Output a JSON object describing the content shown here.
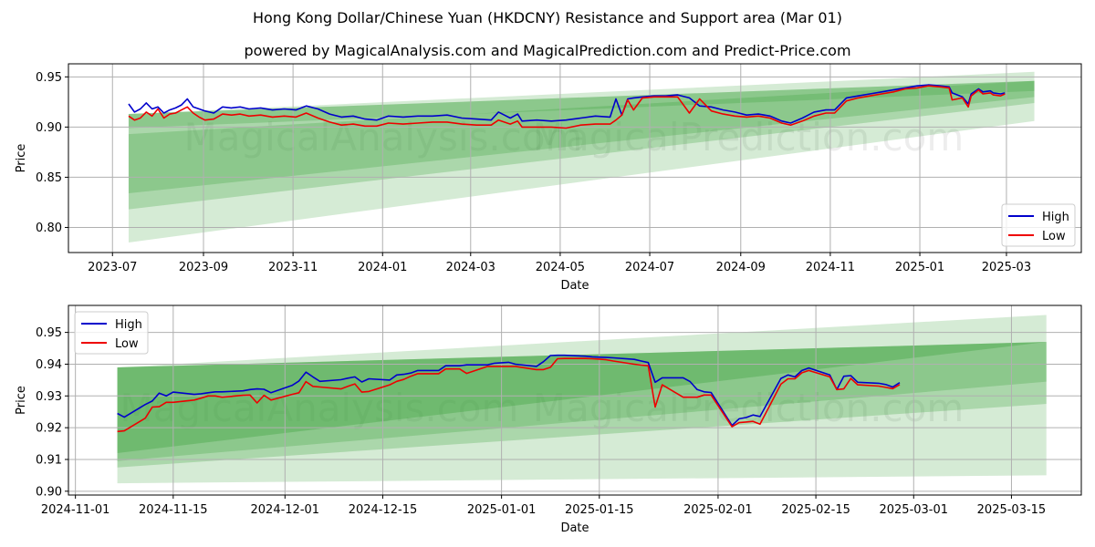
{
  "title": "Hong Kong Dollar/Chinese Yuan (HKDCNY) Resistance and Support area (Mar 01)",
  "subtitle": "powered by MagicalAnalysis.com and MagicalPrediction.com and Predict-Price.com",
  "watermarks": [
    "MagicalAnalysis.com",
    "MagicalPrediction.com"
  ],
  "colors": {
    "high": "#0000cc",
    "low": "#ee0000",
    "band": "#2e9a2e",
    "grid": "#b0b0b0"
  },
  "chart_data": [
    {
      "type": "line",
      "title": "",
      "xlabel": "Date",
      "ylabel": "Price",
      "x_ticks": [
        "2023-07",
        "2023-09",
        "2023-11",
        "2024-01",
        "2024-03",
        "2024-05",
        "2024-07",
        "2024-09",
        "2024-11",
        "2025-01",
        "2025-03"
      ],
      "y_ticks": [
        "0.80",
        "0.85",
        "0.90",
        "0.95"
      ],
      "xlim": [
        "2023-06-01",
        "2025-04-21"
      ],
      "ylim": [
        0.775,
        0.963
      ],
      "grid": true,
      "legend_position": "bottom-right",
      "legend": [
        "High",
        "Low"
      ],
      "bands": [
        {
          "x": [
            "2023-07-12",
            "2025-03-20"
          ],
          "lower": [
            0.785,
            0.906
          ],
          "upper": [
            0.913,
            0.955
          ],
          "alpha": 0.2
        },
        {
          "x": [
            "2023-07-12",
            "2025-03-20"
          ],
          "lower": [
            0.818,
            0.924
          ],
          "upper": [
            0.913,
            0.946
          ],
          "alpha": 0.25
        },
        {
          "x": [
            "2023-07-12",
            "2025-03-20"
          ],
          "lower": [
            0.834,
            0.93
          ],
          "upper": [
            0.893,
            0.946
          ],
          "alpha": 0.25
        },
        {
          "x": [
            "2023-07-12",
            "2025-03-20"
          ],
          "lower": [
            0.899,
            0.936
          ],
          "upper": [
            0.913,
            0.946
          ],
          "alpha": 0.25
        }
      ],
      "series": [
        {
          "name": "High",
          "x": [
            "2023-07-12",
            "2023-07-16",
            "2023-07-20",
            "2023-07-24",
            "2023-07-28",
            "2023-08-01",
            "2023-08-05",
            "2023-08-09",
            "2023-08-13",
            "2023-08-17",
            "2023-08-21",
            "2023-08-25",
            "2023-08-29",
            "2023-09-02",
            "2023-09-08",
            "2023-09-14",
            "2023-09-20",
            "2023-09-26",
            "2023-10-02",
            "2023-10-10",
            "2023-10-18",
            "2023-10-26",
            "2023-11-03",
            "2023-11-10",
            "2023-11-18",
            "2023-11-26",
            "2023-12-04",
            "2023-12-12",
            "2023-12-20",
            "2023-12-28",
            "2024-01-05",
            "2024-01-15",
            "2024-01-25",
            "2024-02-04",
            "2024-02-14",
            "2024-02-24",
            "2024-03-05",
            "2024-03-15",
            "2024-03-20",
            "2024-03-28",
            "2024-04-02",
            "2024-04-05",
            "2024-04-15",
            "2024-04-25",
            "2024-05-05",
            "2024-05-15",
            "2024-05-25",
            "2024-06-04",
            "2024-06-08",
            "2024-06-12",
            "2024-06-16",
            "2024-06-20",
            "2024-06-26",
            "2024-07-04",
            "2024-07-12",
            "2024-07-20",
            "2024-07-28",
            "2024-08-04",
            "2024-08-12",
            "2024-08-20",
            "2024-08-28",
            "2024-09-05",
            "2024-09-13",
            "2024-09-21",
            "2024-09-29",
            "2024-10-05",
            "2024-10-13",
            "2024-10-21",
            "2024-10-29",
            "2024-11-04",
            "2024-11-12",
            "2024-11-20",
            "2024-11-28",
            "2024-12-06",
            "2024-12-14",
            "2024-12-22",
            "2024-12-30",
            "2025-01-07",
            "2025-01-15",
            "2025-01-21",
            "2025-01-23",
            "2025-01-30",
            "2025-02-03",
            "2025-02-05",
            "2025-02-10",
            "2025-02-13",
            "2025-02-18",
            "2025-02-20",
            "2025-02-25",
            "2025-02-28"
          ],
          "y": [
            0.923,
            0.915,
            0.918,
            0.924,
            0.918,
            0.92,
            0.914,
            0.917,
            0.919,
            0.922,
            0.928,
            0.92,
            0.918,
            0.916,
            0.914,
            0.92,
            0.919,
            0.92,
            0.918,
            0.919,
            0.917,
            0.918,
            0.917,
            0.921,
            0.918,
            0.913,
            0.91,
            0.911,
            0.908,
            0.907,
            0.911,
            0.91,
            0.911,
            0.911,
            0.912,
            0.909,
            0.908,
            0.907,
            0.915,
            0.909,
            0.913,
            0.906,
            0.907,
            0.906,
            0.907,
            0.909,
            0.911,
            0.91,
            0.928,
            0.912,
            0.928,
            0.929,
            0.93,
            0.931,
            0.931,
            0.932,
            0.929,
            0.921,
            0.92,
            0.917,
            0.915,
            0.912,
            0.913,
            0.911,
            0.906,
            0.904,
            0.909,
            0.915,
            0.917,
            0.917,
            0.929,
            0.931,
            0.933,
            0.935,
            0.937,
            0.939,
            0.941,
            0.942,
            0.941,
            0.94,
            0.934,
            0.93,
            0.923,
            0.933,
            0.938,
            0.935,
            0.936,
            0.934,
            0.933,
            0.934
          ]
        },
        {
          "name": "Low",
          "x": [
            "2023-07-12",
            "2023-07-16",
            "2023-07-20",
            "2023-07-24",
            "2023-07-28",
            "2023-08-01",
            "2023-08-05",
            "2023-08-09",
            "2023-08-13",
            "2023-08-17",
            "2023-08-21",
            "2023-08-25",
            "2023-08-29",
            "2023-09-02",
            "2023-09-08",
            "2023-09-14",
            "2023-09-20",
            "2023-09-26",
            "2023-10-02",
            "2023-10-10",
            "2023-10-18",
            "2023-10-26",
            "2023-11-03",
            "2023-11-10",
            "2023-11-18",
            "2023-11-26",
            "2023-12-04",
            "2023-12-12",
            "2023-12-20",
            "2023-12-28",
            "2024-01-05",
            "2024-01-15",
            "2024-01-25",
            "2024-02-04",
            "2024-02-14",
            "2024-02-24",
            "2024-03-05",
            "2024-03-15",
            "2024-03-20",
            "2024-03-28",
            "2024-04-02",
            "2024-04-05",
            "2024-04-15",
            "2024-04-25",
            "2024-05-05",
            "2024-05-15",
            "2024-05-25",
            "2024-06-04",
            "2024-06-08",
            "2024-06-12",
            "2024-06-16",
            "2024-06-20",
            "2024-06-26",
            "2024-07-04",
            "2024-07-12",
            "2024-07-20",
            "2024-07-28",
            "2024-08-04",
            "2024-08-12",
            "2024-08-20",
            "2024-08-28",
            "2024-09-05",
            "2024-09-13",
            "2024-09-21",
            "2024-09-29",
            "2024-10-05",
            "2024-10-13",
            "2024-10-21",
            "2024-10-29",
            "2024-11-04",
            "2024-11-12",
            "2024-11-20",
            "2024-11-28",
            "2024-12-06",
            "2024-12-14",
            "2024-12-22",
            "2024-12-30",
            "2025-01-07",
            "2025-01-15",
            "2025-01-21",
            "2025-01-23",
            "2025-01-30",
            "2025-02-03",
            "2025-02-05",
            "2025-02-10",
            "2025-02-13",
            "2025-02-18",
            "2025-02-20",
            "2025-02-25",
            "2025-02-28"
          ],
          "y": [
            0.911,
            0.907,
            0.909,
            0.915,
            0.911,
            0.918,
            0.909,
            0.913,
            0.914,
            0.917,
            0.92,
            0.914,
            0.91,
            0.907,
            0.908,
            0.913,
            0.912,
            0.913,
            0.911,
            0.912,
            0.91,
            0.911,
            0.91,
            0.914,
            0.909,
            0.905,
            0.902,
            0.903,
            0.901,
            0.901,
            0.904,
            0.903,
            0.904,
            0.905,
            0.905,
            0.903,
            0.902,
            0.902,
            0.907,
            0.903,
            0.906,
            0.9,
            0.9,
            0.9,
            0.899,
            0.902,
            0.903,
            0.903,
            0.907,
            0.912,
            0.927,
            0.917,
            0.929,
            0.93,
            0.93,
            0.93,
            0.914,
            0.928,
            0.916,
            0.913,
            0.911,
            0.91,
            0.911,
            0.909,
            0.904,
            0.902,
            0.906,
            0.911,
            0.914,
            0.914,
            0.926,
            0.929,
            0.931,
            0.933,
            0.935,
            0.938,
            0.939,
            0.941,
            0.94,
            0.939,
            0.927,
            0.929,
            0.92,
            0.931,
            0.937,
            0.933,
            0.934,
            0.932,
            0.931,
            0.933
          ]
        }
      ]
    },
    {
      "type": "line",
      "title": "",
      "xlabel": "Date",
      "ylabel": "Price",
      "x_ticks": [
        "2024-11-01",
        "2024-11-15",
        "2024-12-01",
        "2024-12-15",
        "2025-01-01",
        "2025-01-15",
        "2025-02-01",
        "2025-02-15",
        "2025-03-01",
        "2025-03-15"
      ],
      "y_ticks": [
        "0.90",
        "0.91",
        "0.92",
        "0.93",
        "0.94",
        "0.95"
      ],
      "xlim": [
        "2024-10-31",
        "2025-03-25"
      ],
      "ylim": [
        0.8988,
        0.9585
      ],
      "grid": true,
      "legend_position": "top-left",
      "legend": [
        "High",
        "Low"
      ],
      "bands": [
        {
          "x": [
            "2024-11-07",
            "2025-03-20"
          ],
          "lower": [
            0.9025,
            0.905
          ],
          "upper": [
            0.939,
            0.9555
          ],
          "alpha": 0.2
        },
        {
          "x": [
            "2024-11-07",
            "2025-03-20"
          ],
          "lower": [
            0.9075,
            0.9275
          ],
          "upper": [
            0.939,
            0.947
          ],
          "alpha": 0.25
        },
        {
          "x": [
            "2024-11-07",
            "2025-03-20"
          ],
          "lower": [
            0.9095,
            0.9345
          ],
          "upper": [
            0.939,
            0.947
          ],
          "alpha": 0.25
        },
        {
          "x": [
            "2024-11-07",
            "2025-03-20"
          ],
          "lower": [
            0.912,
            0.947
          ],
          "upper": [
            0.939,
            0.947
          ],
          "alpha": 0.3
        }
      ],
      "series": [
        {
          "name": "High",
          "x": [
            "2024-11-07",
            "2024-11-08",
            "2024-11-11",
            "2024-11-12",
            "2024-11-13",
            "2024-11-14",
            "2024-11-15",
            "2024-11-18",
            "2024-11-19",
            "2024-11-20",
            "2024-11-21",
            "2024-11-22",
            "2024-11-25",
            "2024-11-26",
            "2024-11-27",
            "2024-11-28",
            "2024-11-29",
            "2024-12-02",
            "2024-12-03",
            "2024-12-04",
            "2024-12-05",
            "2024-12-06",
            "2024-12-09",
            "2024-12-10",
            "2024-12-11",
            "2024-12-12",
            "2024-12-13",
            "2024-12-16",
            "2024-12-17",
            "2024-12-18",
            "2024-12-19",
            "2024-12-20",
            "2024-12-23",
            "2024-12-24",
            "2024-12-25",
            "2024-12-26",
            "2024-12-27",
            "2024-12-30",
            "2024-12-31",
            "2025-01-02",
            "2025-01-03",
            "2025-01-06",
            "2025-01-07",
            "2025-01-08",
            "2025-01-09",
            "2025-01-10",
            "2025-01-13",
            "2025-01-14",
            "2025-01-15",
            "2025-01-16",
            "2025-01-17",
            "2025-01-20",
            "2025-01-21",
            "2025-01-22",
            "2025-01-23",
            "2025-01-24",
            "2025-01-27",
            "2025-01-28",
            "2025-01-29",
            "2025-01-30",
            "2025-01-31",
            "2025-02-03",
            "2025-02-04",
            "2025-02-05",
            "2025-02-06",
            "2025-02-07",
            "2025-02-10",
            "2025-02-11",
            "2025-02-12",
            "2025-02-13",
            "2025-02-14",
            "2025-02-17",
            "2025-02-18",
            "2025-02-19",
            "2025-02-20",
            "2025-02-21",
            "2025-02-24",
            "2025-02-25",
            "2025-02-26",
            "2025-02-27"
          ],
          "y": [
            0.9245,
            0.9233,
            0.9273,
            0.9284,
            0.9309,
            0.93,
            0.9312,
            0.9305,
            0.9307,
            0.931,
            0.9313,
            0.9313,
            0.9316,
            0.932,
            0.9322,
            0.9321,
            0.931,
            0.9333,
            0.9347,
            0.9375,
            0.936,
            0.9346,
            0.9351,
            0.9356,
            0.936,
            0.9344,
            0.9354,
            0.935,
            0.9366,
            0.9368,
            0.9372,
            0.938,
            0.938,
            0.9395,
            0.9395,
            0.9395,
            0.9398,
            0.9398,
            0.9403,
            0.9406,
            0.94,
            0.9393,
            0.9408,
            0.9427,
            0.9428,
            0.9428,
            0.9425,
            0.9423,
            0.9422,
            0.9421,
            0.942,
            0.9415,
            0.941,
            0.9405,
            0.9343,
            0.9357,
            0.9357,
            0.9345,
            0.932,
            0.9313,
            0.9311,
            0.9207,
            0.9228,
            0.9232,
            0.924,
            0.9235,
            0.9355,
            0.9366,
            0.936,
            0.938,
            0.9388,
            0.9366,
            0.932,
            0.9362,
            0.9364,
            0.9343,
            0.934,
            0.9336,
            0.9328,
            0.9342
          ]
        },
        {
          "name": "Low",
          "x": [
            "2024-11-07",
            "2024-11-08",
            "2024-11-11",
            "2024-11-12",
            "2024-11-13",
            "2024-11-14",
            "2024-11-15",
            "2024-11-18",
            "2024-11-19",
            "2024-11-20",
            "2024-11-21",
            "2024-11-22",
            "2024-11-25",
            "2024-11-26",
            "2024-11-27",
            "2024-11-28",
            "2024-11-29",
            "2024-12-02",
            "2024-12-03",
            "2024-12-04",
            "2024-12-05",
            "2024-12-06",
            "2024-12-09",
            "2024-12-10",
            "2024-12-11",
            "2024-12-12",
            "2024-12-13",
            "2024-12-16",
            "2024-12-17",
            "2024-12-18",
            "2024-12-19",
            "2024-12-20",
            "2024-12-23",
            "2024-12-24",
            "2024-12-25",
            "2024-12-26",
            "2024-12-27",
            "2024-12-30",
            "2024-12-31",
            "2025-01-02",
            "2025-01-03",
            "2025-01-06",
            "2025-01-07",
            "2025-01-08",
            "2025-01-09",
            "2025-01-10",
            "2025-01-13",
            "2025-01-14",
            "2025-01-15",
            "2025-01-16",
            "2025-01-17",
            "2025-01-20",
            "2025-01-21",
            "2025-01-22",
            "2025-01-23",
            "2025-01-24",
            "2025-01-27",
            "2025-01-28",
            "2025-01-29",
            "2025-01-30",
            "2025-01-31",
            "2025-02-03",
            "2025-02-04",
            "2025-02-05",
            "2025-02-06",
            "2025-02-07",
            "2025-02-10",
            "2025-02-11",
            "2025-02-12",
            "2025-02-13",
            "2025-02-14",
            "2025-02-17",
            "2025-02-18",
            "2025-02-19",
            "2025-02-20",
            "2025-02-21",
            "2025-02-24",
            "2025-02-25",
            "2025-02-26",
            "2025-02-27"
          ],
          "y": [
            0.9188,
            0.919,
            0.923,
            0.9265,
            0.9266,
            0.928,
            0.928,
            0.9287,
            0.9293,
            0.93,
            0.93,
            0.9296,
            0.9302,
            0.9303,
            0.9278,
            0.9302,
            0.9287,
            0.9305,
            0.931,
            0.9345,
            0.933,
            0.9328,
            0.9322,
            0.933,
            0.9338,
            0.9312,
            0.9314,
            0.9335,
            0.9346,
            0.9352,
            0.9362,
            0.937,
            0.937,
            0.9385,
            0.9385,
            0.9385,
            0.9371,
            0.9393,
            0.9393,
            0.9393,
            0.9393,
            0.9383,
            0.9383,
            0.939,
            0.9417,
            0.9418,
            0.9418,
            0.9417,
            0.9416,
            0.9414,
            0.941,
            0.94,
            0.9397,
            0.9395,
            0.9265,
            0.9335,
            0.9296,
            0.9296,
            0.9296,
            0.9303,
            0.9303,
            0.9203,
            0.9216,
            0.9218,
            0.922,
            0.9211,
            0.9337,
            0.9354,
            0.9354,
            0.9373,
            0.938,
            0.936,
            0.932,
            0.9322,
            0.9355,
            0.9335,
            0.9331,
            0.9327,
            0.9323,
            0.9336
          ]
        }
      ]
    }
  ]
}
